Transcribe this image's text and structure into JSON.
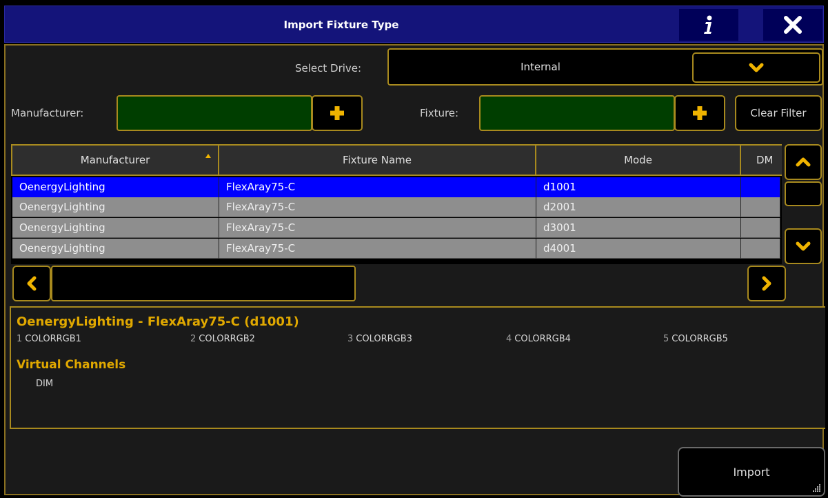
{
  "window": {
    "title": "Import Fixture Type"
  },
  "titlebar": {
    "info_icon": "info-icon",
    "close_icon": "close-icon"
  },
  "drive": {
    "label": "Select Drive:",
    "value": "Internal",
    "dropdown_icon": "chevron-down-icon"
  },
  "filters": {
    "manufacturer_label": "Manufacturer:",
    "manufacturer_value": "",
    "fixture_label": "Fixture:",
    "fixture_value": "",
    "clear_label": "Clear Filter"
  },
  "table": {
    "columns": [
      "Manufacturer",
      "Fixture Name",
      "Mode",
      "DM"
    ],
    "sorted_column": "Manufacturer",
    "rows": [
      {
        "manufacturer": "OenergyLighting",
        "fixture": "FlexAray75-C",
        "mode": "d1001",
        "dmx": "",
        "selected": true
      },
      {
        "manufacturer": "OenergyLighting",
        "fixture": "FlexAray75-C",
        "mode": "d2001",
        "dmx": "",
        "selected": false
      },
      {
        "manufacturer": "OenergyLighting",
        "fixture": "FlexAray75-C",
        "mode": "d3001",
        "dmx": "",
        "selected": false
      },
      {
        "manufacturer": "OenergyLighting",
        "fixture": "FlexAray75-C",
        "mode": "d4001",
        "dmx": "",
        "selected": false
      }
    ]
  },
  "details": {
    "title": "OenergyLighting - FlexAray75-C (d1001)",
    "channels": [
      {
        "num": "1",
        "name": "COLORRGB1"
      },
      {
        "num": "2",
        "name": "COLORRGB2"
      },
      {
        "num": "3",
        "name": "COLORRGB3"
      },
      {
        "num": "4",
        "name": "COLORRGB4"
      },
      {
        "num": "5",
        "name": "COLORRGB5"
      }
    ],
    "virtual_title": "Virtual Channels",
    "virtual_items": [
      "DIM"
    ]
  },
  "actions": {
    "import_label": "Import"
  },
  "colors": {
    "accent": "#a88a1e",
    "title_bg": "#14147a",
    "selection": "#0000ff",
    "highlight_text": "#e0a800",
    "field_green": "#003e00"
  }
}
